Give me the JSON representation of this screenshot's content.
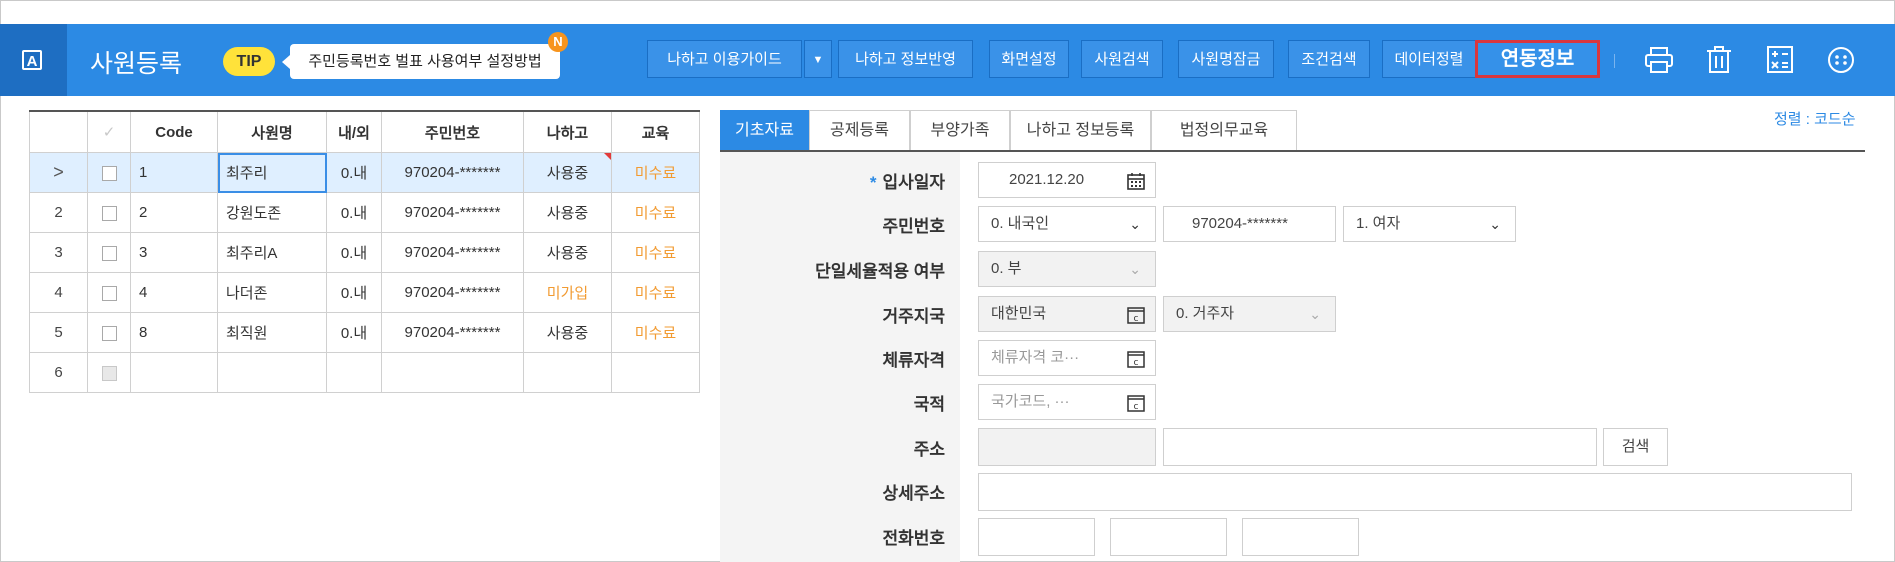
{
  "app": {
    "icon_letter": "A",
    "title": "사원등록"
  },
  "tip": {
    "badge": "TIP",
    "text": "주민등록번호 벌표 사용여부 설정방법",
    "new_badge": "N"
  },
  "toolbar": {
    "guide": "나하고 이용가이드",
    "reflect": "나하고 정보반영",
    "screen_settings": "화면설정",
    "search_employee": "사원검색",
    "name_lock": "사원명잠금",
    "condition_search": "조건검색",
    "data_sort": "데이터정렬",
    "link_info": "연동정보",
    "icons": [
      "print-icon",
      "trash-icon",
      "calculator-icon",
      "more-icon"
    ]
  },
  "grid": {
    "headers": [
      "",
      "✓",
      "Code",
      "사원명",
      "내/외",
      "주민번호",
      "나하고",
      "교육"
    ],
    "rows": [
      {
        "rn": ">",
        "code": "1",
        "name": "최주리",
        "inout": "0.내",
        "rrn": "970204-*******",
        "nahago": "사용중",
        "edu": "미수료"
      },
      {
        "rn": "2",
        "code": "2",
        "name": "강원도존",
        "inout": "0.내",
        "rrn": "970204-*******",
        "nahago": "사용중",
        "edu": "미수료"
      },
      {
        "rn": "3",
        "code": "3",
        "name": "최주리A",
        "inout": "0.내",
        "rrn": "970204-*******",
        "nahago": "사용중",
        "edu": "미수료"
      },
      {
        "rn": "4",
        "code": "4",
        "name": "나더존",
        "inout": "0.내",
        "rrn": "970204-*******",
        "nahago": "미가입",
        "edu": "미수료"
      },
      {
        "rn": "5",
        "code": "8",
        "name": "최직원",
        "inout": "0.내",
        "rrn": "970204-*******",
        "nahago": "사용중",
        "edu": "미수료"
      },
      {
        "rn": "6",
        "code": "",
        "name": "",
        "inout": "",
        "rrn": "",
        "nahago": "",
        "edu": ""
      }
    ]
  },
  "tabs": [
    "기초자료",
    "공제등록",
    "부양가족",
    "나하고 정보등록",
    "법정의무교육"
  ],
  "sort": "정렬 : 코드순",
  "form": {
    "hire_date": {
      "label": "입사일자",
      "required": "*",
      "value": "2021.12.20"
    },
    "rrn": {
      "label": "주민번호",
      "type": "0. 내국인",
      "number": "970204-*******",
      "gender": "1. 여자"
    },
    "single_tax": {
      "label": "단일세율적용 여부",
      "value": "0. 부"
    },
    "residence": {
      "label": "거주지국",
      "country": "대한민국",
      "type": "0. 거주자"
    },
    "visa": {
      "label": "체류자격",
      "placeholder": "체류자격 코···"
    },
    "nationality": {
      "label": "국적",
      "placeholder": "국가코드, ···"
    },
    "address": {
      "label": "주소",
      "search": "검색"
    },
    "address_detail": {
      "label": "상세주소"
    },
    "phone": {
      "label": "전화번호"
    }
  }
}
